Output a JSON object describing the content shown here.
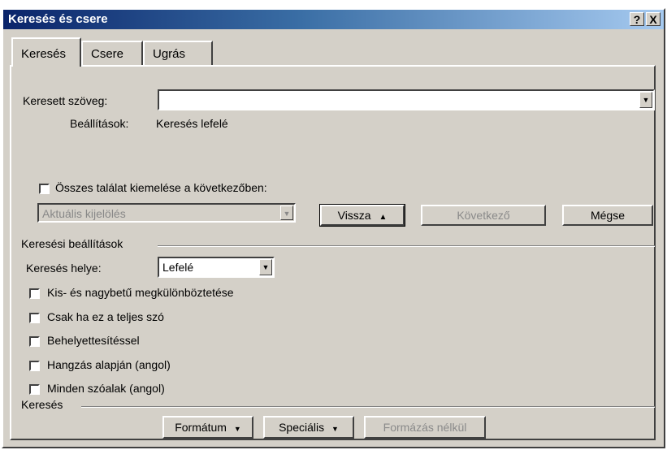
{
  "window": {
    "title": "Keresés és csere",
    "help_label": "?",
    "close_label": "X"
  },
  "tabs": [
    {
      "label": "Keresés",
      "active": true
    },
    {
      "label": "Csere",
      "active": false
    },
    {
      "label": "Ugrás",
      "active": false
    }
  ],
  "search": {
    "label": "Keresett szöveg:",
    "value": "",
    "settings_label": "Beállítások:",
    "settings_value": "Keresés lefelé"
  },
  "highlight": {
    "checkbox_label": "Összes találat kiemelése a következőben:",
    "checked": false,
    "scope_value": "Aktuális kijelölés"
  },
  "buttons": {
    "back": "Vissza",
    "next": "Következő",
    "cancel": "Mégse"
  },
  "options": {
    "group_title": "Keresési beállítások",
    "direction_label": "Keresés helye:",
    "direction_value": "Lefelé",
    "checkboxes": [
      {
        "label": "Kis- és nagybetű megkülönböztetése",
        "checked": false
      },
      {
        "label": "Csak ha ez a teljes szó",
        "checked": false
      },
      {
        "label": "Behelyettesítéssel",
        "checked": false
      },
      {
        "label": "Hangzás alapján (angol)",
        "checked": false
      },
      {
        "label": "Minden szóalak (angol)",
        "checked": false
      }
    ]
  },
  "search_group": {
    "title": "Keresés",
    "format_button": "Formátum",
    "special_button": "Speciális",
    "no_format_button": "Formázás nélkül"
  },
  "icons": {
    "dropdown": "chevron-down-icon",
    "back_arrow": "up-arrow-icon"
  }
}
